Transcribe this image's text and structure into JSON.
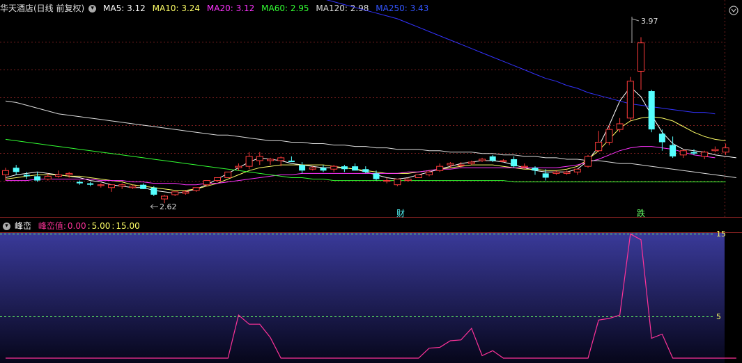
{
  "main_header": {
    "title": "华天酒店(日线 前复权)",
    "ma5": "MA5: 3.12",
    "ma10": "MA10: 3.24",
    "ma20": "MA20: 3.12",
    "ma60": "MA60: 2.95",
    "ma120": "MA120: 2.98",
    "ma250": "MA250: 3.43"
  },
  "sub_header": {
    "title": "峰峦",
    "label": "峰峦值:",
    "v1": "0.00",
    "v2": "5.00",
    "v3": "15.00"
  },
  "annotations": {
    "high_label": "3.97",
    "low_label": "2.62",
    "marker_cai": "财",
    "marker_die": "跌"
  },
  "sub_axis": {
    "tick_15": "15",
    "tick_5": "5"
  },
  "colors": {
    "up": "#ff3b3b",
    "down": "#55ffff",
    "ma5": "#ffffff",
    "ma10": "#ffff66",
    "ma20": "#ff33ff",
    "ma60": "#33ff33",
    "ma120": "#dddddd",
    "ma250": "#3333ff",
    "indicator": "#ff3399"
  },
  "chart_data": [
    {
      "type": "candlestick",
      "title": "华天酒店(日线 前复权)",
      "candles": [
        {
          "o": 3.0,
          "h": 3.05,
          "l": 2.96,
          "c": 3.03
        },
        {
          "o": 3.05,
          "h": 3.07,
          "l": 3.0,
          "c": 3.02
        },
        {
          "o": 3.0,
          "h": 3.02,
          "l": 2.97,
          "c": 2.99
        },
        {
          "o": 2.99,
          "h": 3.02,
          "l": 2.95,
          "c": 2.96
        },
        {
          "o": 2.97,
          "h": 3.01,
          "l": 2.96,
          "c": 2.99
        },
        {
          "o": 2.99,
          "h": 3.03,
          "l": 2.98,
          "c": 3.0
        },
        {
          "o": 3.0,
          "h": 3.02,
          "l": 2.98,
          "c": 3.01
        },
        {
          "o": 2.95,
          "h": 2.96,
          "l": 2.93,
          "c": 2.94
        },
        {
          "o": 2.94,
          "h": 2.95,
          "l": 2.92,
          "c": 2.93
        },
        {
          "o": 2.93,
          "h": 2.94,
          "l": 2.91,
          "c": 2.93
        },
        {
          "o": 2.91,
          "h": 2.93,
          "l": 2.88,
          "c": 2.93
        },
        {
          "o": 2.92,
          "h": 2.94,
          "l": 2.9,
          "c": 2.93
        },
        {
          "o": 2.91,
          "h": 2.93,
          "l": 2.9,
          "c": 2.92
        },
        {
          "o": 2.93,
          "h": 2.94,
          "l": 2.9,
          "c": 2.9
        },
        {
          "o": 2.91,
          "h": 2.92,
          "l": 2.85,
          "c": 2.86
        },
        {
          "o": 2.83,
          "h": 2.86,
          "l": 2.8,
          "c": 2.85
        },
        {
          "o": 2.86,
          "h": 2.88,
          "l": 2.85,
          "c": 2.88
        },
        {
          "o": 2.87,
          "h": 2.89,
          "l": 2.86,
          "c": 2.88
        },
        {
          "o": 2.89,
          "h": 2.91,
          "l": 2.88,
          "c": 2.91
        },
        {
          "o": 2.93,
          "h": 2.96,
          "l": 2.92,
          "c": 2.96
        },
        {
          "o": 2.96,
          "h": 2.98,
          "l": 2.95,
          "c": 2.98
        },
        {
          "o": 2.98,
          "h": 3.02,
          "l": 2.98,
          "c": 3.02
        },
        {
          "o": 3.05,
          "h": 3.08,
          "l": 3.03,
          "c": 3.06
        },
        {
          "o": 3.06,
          "h": 3.16,
          "l": 3.04,
          "c": 3.13
        },
        {
          "o": 3.1,
          "h": 3.16,
          "l": 3.07,
          "c": 3.13
        },
        {
          "o": 3.1,
          "h": 3.12,
          "l": 3.07,
          "c": 3.11
        },
        {
          "o": 3.1,
          "h": 3.13,
          "l": 3.06,
          "c": 3.12
        },
        {
          "o": 3.1,
          "h": 3.13,
          "l": 3.09,
          "c": 3.09
        },
        {
          "o": 3.07,
          "h": 3.09,
          "l": 3.01,
          "c": 3.03
        },
        {
          "o": 3.04,
          "h": 3.06,
          "l": 3.03,
          "c": 3.05
        },
        {
          "o": 3.05,
          "h": 3.07,
          "l": 3.02,
          "c": 3.03
        },
        {
          "o": 3.04,
          "h": 3.07,
          "l": 3.02,
          "c": 3.06
        },
        {
          "o": 3.06,
          "h": 3.07,
          "l": 3.02,
          "c": 3.04
        },
        {
          "o": 3.06,
          "h": 3.08,
          "l": 3.04,
          "c": 3.03
        },
        {
          "o": 3.04,
          "h": 3.06,
          "l": 3.01,
          "c": 3.02
        },
        {
          "o": 3.01,
          "h": 3.03,
          "l": 2.96,
          "c": 2.97
        },
        {
          "o": 2.96,
          "h": 2.98,
          "l": 2.94,
          "c": 2.96
        },
        {
          "o": 2.93,
          "h": 2.97,
          "l": 2.92,
          "c": 2.97
        },
        {
          "o": 2.96,
          "h": 2.98,
          "l": 2.95,
          "c": 2.97
        },
        {
          "o": 2.98,
          "h": 3.0,
          "l": 2.98,
          "c": 3.0
        },
        {
          "o": 3.0,
          "h": 3.03,
          "l": 2.99,
          "c": 3.02
        },
        {
          "o": 3.03,
          "h": 3.08,
          "l": 3.02,
          "c": 3.06
        },
        {
          "o": 3.07,
          "h": 3.09,
          "l": 3.05,
          "c": 3.08
        },
        {
          "o": 3.07,
          "h": 3.09,
          "l": 3.05,
          "c": 3.07
        },
        {
          "o": 3.08,
          "h": 3.1,
          "l": 3.07,
          "c": 3.09
        },
        {
          "o": 3.1,
          "h": 3.12,
          "l": 3.09,
          "c": 3.11
        },
        {
          "o": 3.13,
          "h": 3.14,
          "l": 3.09,
          "c": 3.1
        },
        {
          "o": 3.1,
          "h": 3.11,
          "l": 3.09,
          "c": 3.1
        },
        {
          "o": 3.11,
          "h": 3.13,
          "l": 3.05,
          "c": 3.06
        },
        {
          "o": 3.06,
          "h": 3.08,
          "l": 3.04,
          "c": 3.06
        },
        {
          "o": 3.05,
          "h": 3.06,
          "l": 3.0,
          "c": 3.03
        },
        {
          "o": 3.01,
          "h": 3.04,
          "l": 2.96,
          "c": 2.98
        },
        {
          "o": 3.01,
          "h": 3.03,
          "l": 3.0,
          "c": 3.02
        },
        {
          "o": 3.01,
          "h": 3.03,
          "l": 3.0,
          "c": 3.02
        },
        {
          "o": 3.02,
          "h": 3.04,
          "l": 3.0,
          "c": 3.04
        },
        {
          "o": 3.06,
          "h": 3.14,
          "l": 3.05,
          "c": 3.13
        },
        {
          "o": 3.17,
          "h": 3.31,
          "l": 3.16,
          "c": 3.23
        },
        {
          "o": 3.23,
          "h": 3.35,
          "l": 3.21,
          "c": 3.32
        },
        {
          "o": 3.32,
          "h": 3.4,
          "l": 3.3,
          "c": 3.36
        },
        {
          "o": 3.4,
          "h": 3.69,
          "l": 3.38,
          "c": 3.66
        },
        {
          "o": 3.73,
          "h": 3.97,
          "l": 3.6,
          "c": 3.93
        },
        {
          "o": 3.59,
          "h": 3.6,
          "l": 3.3,
          "c": 3.32
        },
        {
          "o": 3.29,
          "h": 3.32,
          "l": 3.17,
          "c": 3.23
        },
        {
          "o": 3.21,
          "h": 3.27,
          "l": 3.12,
          "c": 3.13
        },
        {
          "o": 3.14,
          "h": 3.18,
          "l": 3.12,
          "c": 3.17
        },
        {
          "o": 3.16,
          "h": 3.18,
          "l": 3.14,
          "c": 3.15
        },
        {
          "o": 3.13,
          "h": 3.17,
          "l": 3.11,
          "c": 3.16
        },
        {
          "o": 3.17,
          "h": 3.2,
          "l": 3.16,
          "c": 3.18
        },
        {
          "o": 3.16,
          "h": 3.22,
          "l": 3.14,
          "c": 3.19
        }
      ],
      "ma_lines": [
        {
          "name": "MA5",
          "values": [
            2.98,
            3.0,
            3.01,
            3.02,
            3.01,
            3.0,
            2.99,
            2.98,
            2.96,
            2.95,
            2.93,
            2.92,
            2.91,
            2.91,
            2.89,
            2.88,
            2.87,
            2.88,
            2.9,
            2.93,
            2.97,
            3.01,
            3.05,
            3.09,
            3.12,
            3.11,
            3.1,
            3.08,
            3.07,
            3.06,
            3.05,
            3.05,
            3.05,
            3.04,
            3.02,
            3.0,
            2.98,
            2.97,
            2.98,
            3.0,
            3.02,
            3.04,
            3.06,
            3.08,
            3.09,
            3.1,
            3.1,
            3.09,
            3.07,
            3.05,
            3.03,
            3.02,
            3.02,
            3.02,
            3.04,
            3.1,
            3.2,
            3.35,
            3.52,
            3.62,
            3.55,
            3.42,
            3.3,
            3.22,
            3.18,
            3.17,
            3.16,
            3.14,
            3.13,
            3.12
          ]
        },
        {
          "name": "MA10",
          "values": [
            2.97,
            2.98,
            2.99,
            3.0,
            3.0,
            3.0,
            2.99,
            2.99,
            2.98,
            2.97,
            2.96,
            2.95,
            2.93,
            2.92,
            2.91,
            2.9,
            2.89,
            2.89,
            2.9,
            2.92,
            2.94,
            2.97,
            3.0,
            3.03,
            3.05,
            3.06,
            3.07,
            3.07,
            3.07,
            3.07,
            3.07,
            3.06,
            3.05,
            3.04,
            3.03,
            3.02,
            3.01,
            3.01,
            3.01,
            3.02,
            3.03,
            3.04,
            3.05,
            3.06,
            3.07,
            3.07,
            3.07,
            3.06,
            3.05,
            3.04,
            3.04,
            3.03,
            3.03,
            3.04,
            3.06,
            3.11,
            3.17,
            3.25,
            3.33,
            3.38,
            3.4,
            3.41,
            3.4,
            3.38,
            3.34,
            3.3,
            3.27,
            3.25,
            3.24
          ]
        },
        {
          "name": "MA20",
          "values": [
            2.96,
            2.96,
            2.96,
            2.97,
            2.97,
            2.97,
            2.97,
            2.97,
            2.97,
            2.96,
            2.96,
            2.96,
            2.95,
            2.95,
            2.94,
            2.94,
            2.94,
            2.93,
            2.93,
            2.94,
            2.94,
            2.95,
            2.96,
            2.97,
            2.98,
            2.99,
            3.0,
            3.0,
            3.01,
            3.01,
            3.01,
            3.01,
            3.01,
            3.01,
            3.01,
            3.01,
            3.01,
            3.01,
            3.02,
            3.02,
            3.03,
            3.04,
            3.04,
            3.05,
            3.05,
            3.05,
            3.05,
            3.05,
            3.05,
            3.05,
            3.05,
            3.05,
            3.05,
            3.06,
            3.07,
            3.09,
            3.11,
            3.14,
            3.17,
            3.19,
            3.2,
            3.2,
            3.19,
            3.18,
            3.16,
            3.14,
            3.13,
            3.12
          ]
        },
        {
          "name": "MA60",
          "values": [
            3.25,
            3.24,
            3.23,
            3.22,
            3.21,
            3.2,
            3.19,
            3.18,
            3.17,
            3.16,
            3.15,
            3.14,
            3.13,
            3.12,
            3.11,
            3.1,
            3.09,
            3.08,
            3.07,
            3.06,
            3.05,
            3.04,
            3.03,
            3.02,
            3.01,
            3.0,
            2.99,
            2.98,
            2.98,
            2.97,
            2.97,
            2.96,
            2.96,
            2.96,
            2.96,
            2.96,
            2.96,
            2.96,
            2.96,
            2.96,
            2.96,
            2.96,
            2.96,
            2.96,
            2.96,
            2.96,
            2.96,
            2.96,
            2.95,
            2.95,
            2.95,
            2.95,
            2.95,
            2.95,
            2.95,
            2.95,
            2.95,
            2.95,
            2.95,
            2.95,
            2.95,
            2.95,
            2.95,
            2.95,
            2.95,
            2.95,
            2.95,
            2.95,
            2.95
          ]
        },
        {
          "name": "MA120",
          "values": [
            3.52,
            3.51,
            3.49,
            3.47,
            3.45,
            3.43,
            3.42,
            3.41,
            3.4,
            3.39,
            3.38,
            3.37,
            3.36,
            3.35,
            3.34,
            3.33,
            3.32,
            3.31,
            3.3,
            3.29,
            3.28,
            3.28,
            3.27,
            3.26,
            3.25,
            3.24,
            3.24,
            3.23,
            3.23,
            3.22,
            3.22,
            3.21,
            3.21,
            3.2,
            3.2,
            3.19,
            3.19,
            3.18,
            3.18,
            3.18,
            3.17,
            3.17,
            3.16,
            3.16,
            3.16,
            3.15,
            3.15,
            3.14,
            3.14,
            3.13,
            3.13,
            3.12,
            3.12,
            3.11,
            3.11,
            3.1,
            3.1,
            3.09,
            3.08,
            3.08,
            3.07,
            3.06,
            3.05,
            3.04,
            3.03,
            3.02,
            3.01,
            3.0,
            2.99,
            2.98
          ]
        },
        {
          "name": "MA250",
          "values": [
            4.58,
            4.57,
            4.56,
            4.55,
            4.54,
            4.53,
            4.52,
            4.51,
            4.5,
            4.49,
            4.48,
            4.47,
            4.46,
            4.45,
            4.44,
            4.43,
            4.42,
            4.41,
            4.4,
            4.39,
            4.38,
            4.37,
            4.36,
            4.35,
            4.34,
            4.33,
            4.31,
            4.3,
            4.28,
            4.26,
            4.24,
            4.22,
            4.2,
            4.18,
            4.16,
            4.14,
            4.12,
            4.1,
            4.07,
            4.04,
            4.01,
            3.98,
            3.95,
            3.92,
            3.89,
            3.86,
            3.83,
            3.8,
            3.77,
            3.74,
            3.71,
            3.68,
            3.66,
            3.63,
            3.61,
            3.58,
            3.56,
            3.54,
            3.52,
            3.5,
            3.49,
            3.48,
            3.47,
            3.46,
            3.45,
            3.44,
            3.44,
            3.43
          ]
        }
      ],
      "annotations": [
        {
          "text": "3.97",
          "type": "high"
        },
        {
          "text": "2.62",
          "type": "low"
        },
        {
          "text": "财",
          "type": "event"
        },
        {
          "text": "跌",
          "type": "event"
        }
      ]
    },
    {
      "type": "line",
      "title": "峰峦",
      "series": [
        {
          "name": "峰峦值",
          "values": [
            0,
            0,
            0,
            0,
            0,
            0,
            0,
            0,
            0,
            0,
            0,
            0,
            0,
            0,
            0,
            0,
            0,
            0,
            0,
            0,
            0,
            0,
            5.2,
            4.1,
            4.1,
            2.5,
            0,
            0,
            0,
            0,
            0,
            0,
            0,
            0,
            0,
            0,
            0,
            0,
            0,
            0,
            1.2,
            1.3,
            2.1,
            2.2,
            3.6,
            0.3,
            0.9,
            0,
            0,
            0,
            0,
            0,
            0,
            0,
            0,
            0,
            4.6,
            4.8,
            5.2,
            15,
            14.3,
            2.4,
            2.9,
            0,
            0,
            0,
            0,
            0,
            0,
            0
          ]
        }
      ],
      "reference_lines": [
        15,
        5
      ],
      "ylim": [
        0,
        15
      ]
    }
  ]
}
